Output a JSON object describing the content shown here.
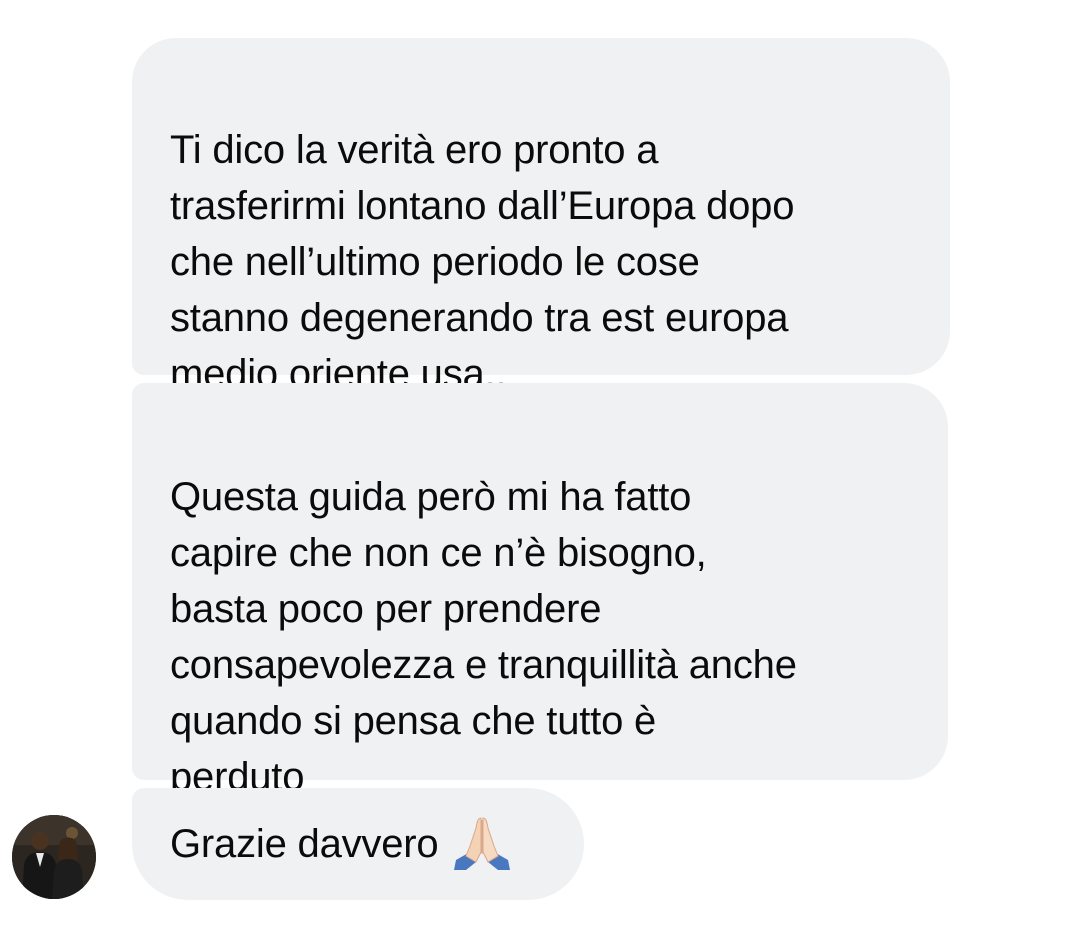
{
  "conversation": {
    "messages": [
      {
        "text": "Ti dico la verità ero pronto a\ntrasferirmi lontano dall’Europa dopo\nche nell’ultimo periodo le cose\nstanno degenerando tra est europa\nmedio oriente usa.."
      },
      {
        "text": "Questa guida però mi ha fatto\ncapire che non ce n’è bisogno,\nbasta poco per prendere\nconsapevolezza e tranquillità anche\nquando si pensa che tutto è\nperduto"
      },
      {
        "text": "Grazie davvero",
        "emoji": "folded-hands"
      }
    ],
    "sender": {
      "avatar": "profile-photo-couple"
    }
  },
  "colors": {
    "background": "#ffffff",
    "bubble": "#f0f1f3",
    "text": "#0b0b0b"
  }
}
